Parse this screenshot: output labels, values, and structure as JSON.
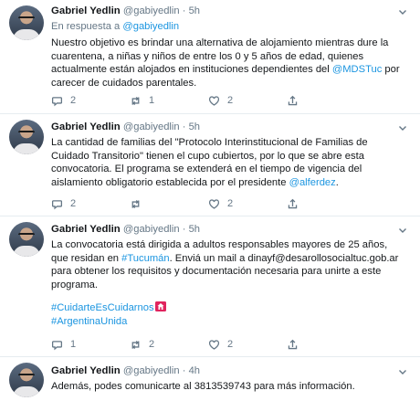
{
  "tweets": [
    {
      "name": "Gabriel Yedlin",
      "handle": "@gabiyedlin",
      "dot": "·",
      "time": "5h",
      "reply_prefix": "En respuesta a ",
      "reply_to": "@gabiyedlin",
      "lines": [
        "Nuestro objetivo es brindar una alternativa de alojamiento mientras dure la",
        "cuarentena, a niñas y niños de entre los 0 y 5 años de edad, quienes",
        "actualmente están alojados en instituciones dependientes del "
      ],
      "mention": "@MDSTuc",
      "after_mention": " por",
      "last_line": "carecer de cuidados parentales.",
      "reply_count": "2",
      "retweet_count": "1",
      "like_count": "2"
    },
    {
      "name": "Gabriel Yedlin",
      "handle": "@gabiyedlin",
      "dot": "·",
      "time": "5h",
      "lines": [
        "La cantidad de familias del \"Protocolo Interinstitucional de Familias de",
        "Cuidado Transitorio\" tienen el cupo cubiertos, por lo que se abre esta",
        "convocatoria. El programa se extenderá en el tiempo de vigencia del",
        "aislamiento obligatorio establecida por el presidente "
      ],
      "mention": "@alferdez",
      "after_mention": ".",
      "reply_count": "2",
      "retweet_count": "",
      "like_count": "2"
    },
    {
      "name": "Gabriel Yedlin",
      "handle": "@gabiyedlin",
      "dot": "·",
      "time": "5h",
      "line1": "La convocatoria está dirigida a adultos responsables mayores de 25 años,",
      "line2_prefix": "que residan en ",
      "hashtag_tucuman": "#Tucumán",
      "line2_suffix": ". Enviá un mail a dinayf@desarollosocialtuc.gob.ar",
      "line3": "para obtener los requisitos y documentación necesaria para unirte a este",
      "line4": "programa.",
      "hashtag1": "#CuidarteEsCuidarnos",
      "hashtag2": "#ArgentinaUnida",
      "reply_count": "1",
      "retweet_count": "2",
      "like_count": "2"
    },
    {
      "name": "Gabriel Yedlin",
      "handle": "@gabiyedlin",
      "dot": "·",
      "time": "4h",
      "line1": "Además, podes comunicarte al 3813539743 para más información."
    }
  ],
  "icons": {
    "reply": "reply-icon",
    "retweet": "retweet-icon",
    "like": "heart-icon",
    "share": "share-icon",
    "more": "chevron-down-icon",
    "house": "house-emoji-icon"
  },
  "colors": {
    "link": "#1b95e0",
    "secondary": "#657786",
    "text": "#14171a",
    "separator": "#e6ecf0"
  }
}
